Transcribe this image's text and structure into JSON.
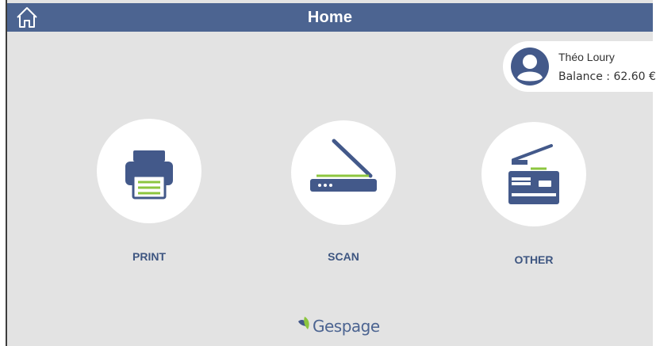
{
  "header": {
    "title": "Home",
    "home_icon": "home-icon"
  },
  "user": {
    "name": "Théo Loury",
    "balance": "Balance : 62.60 €",
    "avatar_icon": "user-avatar-icon"
  },
  "tiles": [
    {
      "label": "PRINT",
      "icon": "printer-icon"
    },
    {
      "label": "SCAN",
      "icon": "scanner-icon"
    },
    {
      "label": "OTHER",
      "icon": "copier-icon"
    }
  ],
  "footer": {
    "logo_text": "Gespage"
  },
  "colors": {
    "header_bg": "#4c6491",
    "icon_blue": "#43598a",
    "accent_green": "#8cc63f",
    "background": "#e3e3e3"
  }
}
